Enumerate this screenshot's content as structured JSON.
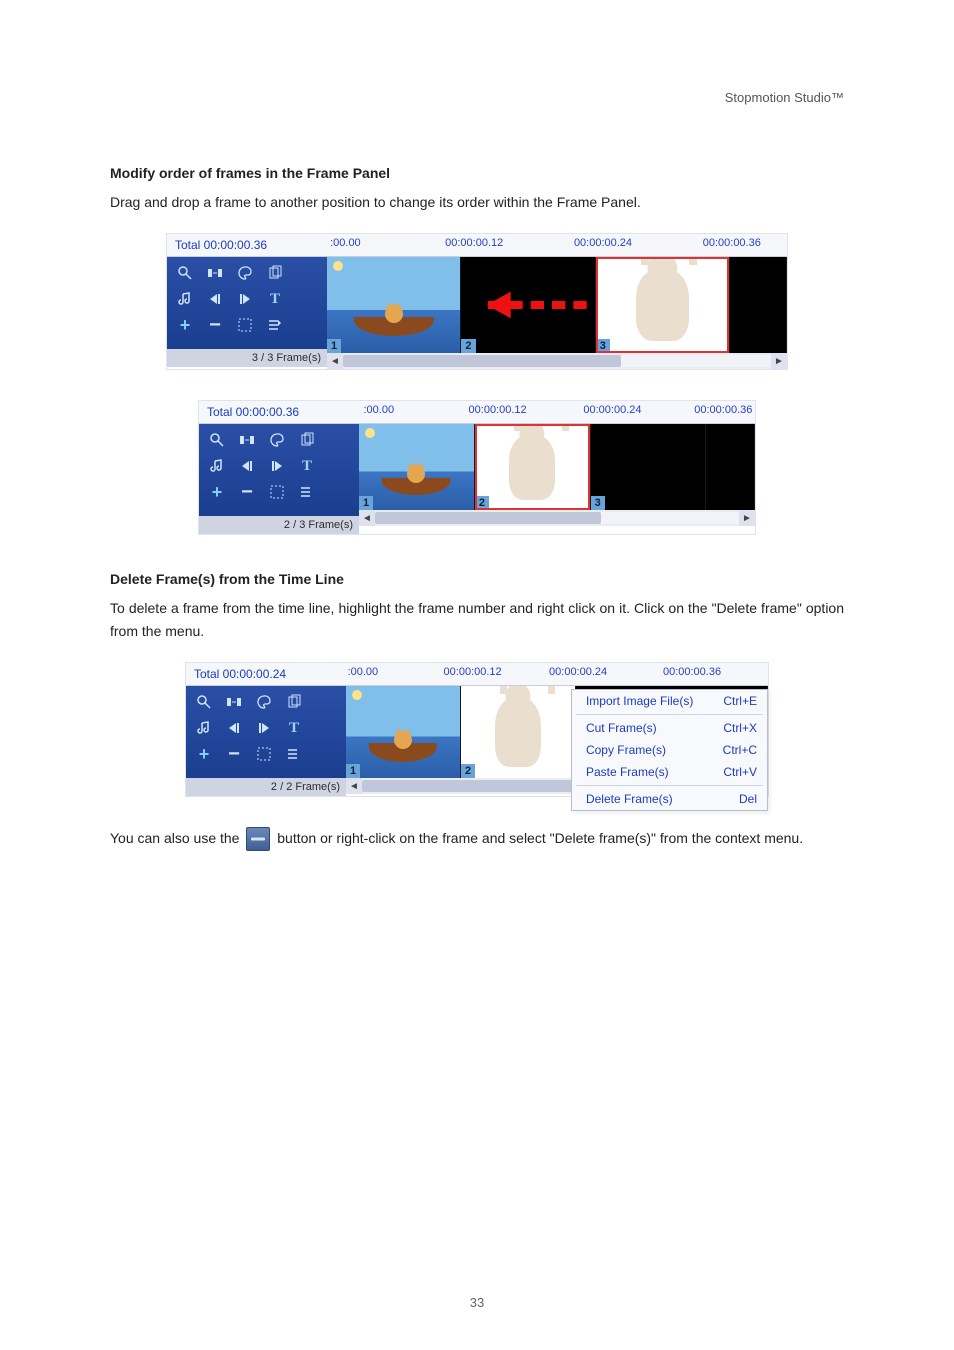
{
  "brand": "Stopmotion Studio™",
  "intro_heading": "Modify order of frames in the Frame Panel",
  "intro_text": "Drag and drop a frame to another position to change its order within the Frame Panel.",
  "fig1": {
    "total": "Total 00:00:00.36",
    "ticks": [
      ":00.00",
      "00:00:00.12",
      "00:00:00.24",
      "00:00:00.36"
    ],
    "framecount": "3 / 3 Frame(s)",
    "num1": "1",
    "num2": "2",
    "num3": "3"
  },
  "fig2": {
    "total": "Total 00:00:00.36",
    "ticks": [
      ":00.00",
      "00:00:00.12",
      "00:00:00.24",
      "00:00:00.36"
    ],
    "framecount": "2 / 3 Frame(s)",
    "num1": "1",
    "num2": "2",
    "num3": "3"
  },
  "del_heading": "Delete Frame(s) from the Time Line",
  "del_text": "To delete a frame from the time line, highlight the frame number and right click on it. Click on the \"Delete frame\" option from the menu.",
  "fig3": {
    "total": "Total 00:00:00.24",
    "ticks": [
      ":00.00",
      "00:00:00.12",
      "00:00:00.24",
      "00:00:00.36"
    ],
    "framecount": "2 / 2 Frame(s)",
    "num1": "1",
    "num2": "2"
  },
  "ctx": {
    "import": "Import Image File(s)",
    "import_sc": "Ctrl+E",
    "cut": "Cut Frame(s)",
    "cut_sc": "Ctrl+X",
    "copy": "Copy Frame(s)",
    "copy_sc": "Ctrl+C",
    "paste": "Paste Frame(s)",
    "paste_sc": "Ctrl+V",
    "delete": "Delete Frame(s)",
    "delete_sc": "Del"
  },
  "tail_text_a": "You can also use the ",
  "tail_text_b": " button or right-click on the frame and select \"Delete frame(s)\" from the context menu.",
  "page_no": "33"
}
